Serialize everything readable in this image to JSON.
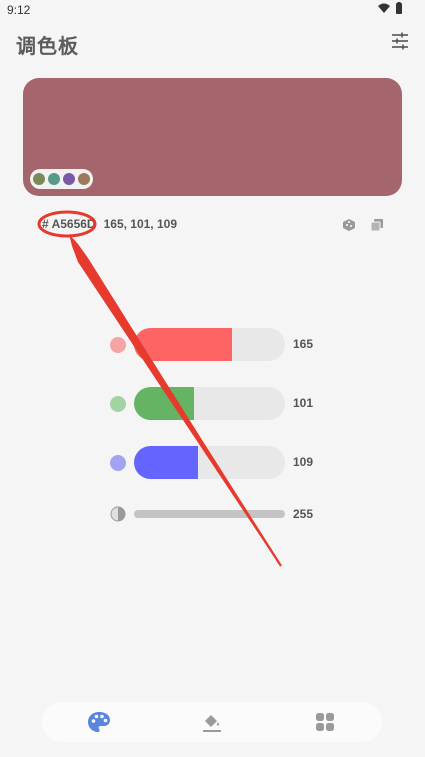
{
  "status_bar": {
    "time": "9:12"
  },
  "app": {
    "title": "调色板"
  },
  "current_color": {
    "hex_text": "# A5656D",
    "rgb_text": "165, 101, 109",
    "swatch": "#A5656D"
  },
  "history_colors": [
    "#7a8a5a",
    "#5a9a8a",
    "#7a5aa5",
    "#9a7a5a"
  ],
  "sliders": [
    {
      "channel": "red",
      "value": 165,
      "value_text": "165",
      "fraction": 0.647,
      "color": "#FF6464",
      "dot_color": "#F7A3A3"
    },
    {
      "channel": "green",
      "value": 101,
      "value_text": "101",
      "fraction": 0.396,
      "color": "#64B464",
      "dot_color": "#A3D3A3"
    },
    {
      "channel": "blue",
      "value": 109,
      "value_text": "109",
      "fraction": 0.427,
      "color": "#6464FF",
      "dot_color": "#A3A3F3"
    }
  ],
  "alpha": {
    "value": 255,
    "value_text": "255",
    "fraction": 1.0
  },
  "colors": {
    "annotation_red": "#E53A2D",
    "nav_active": "#5B86E0",
    "icon_gray": "#9a9a9a"
  },
  "icons": {
    "settings": "tune-sliders-icon",
    "random": "dice-icon",
    "copy": "copy-icon",
    "nav_palette": "palette-icon",
    "nav_fill": "paint-bucket-icon",
    "nav_grid": "grid-icon"
  }
}
